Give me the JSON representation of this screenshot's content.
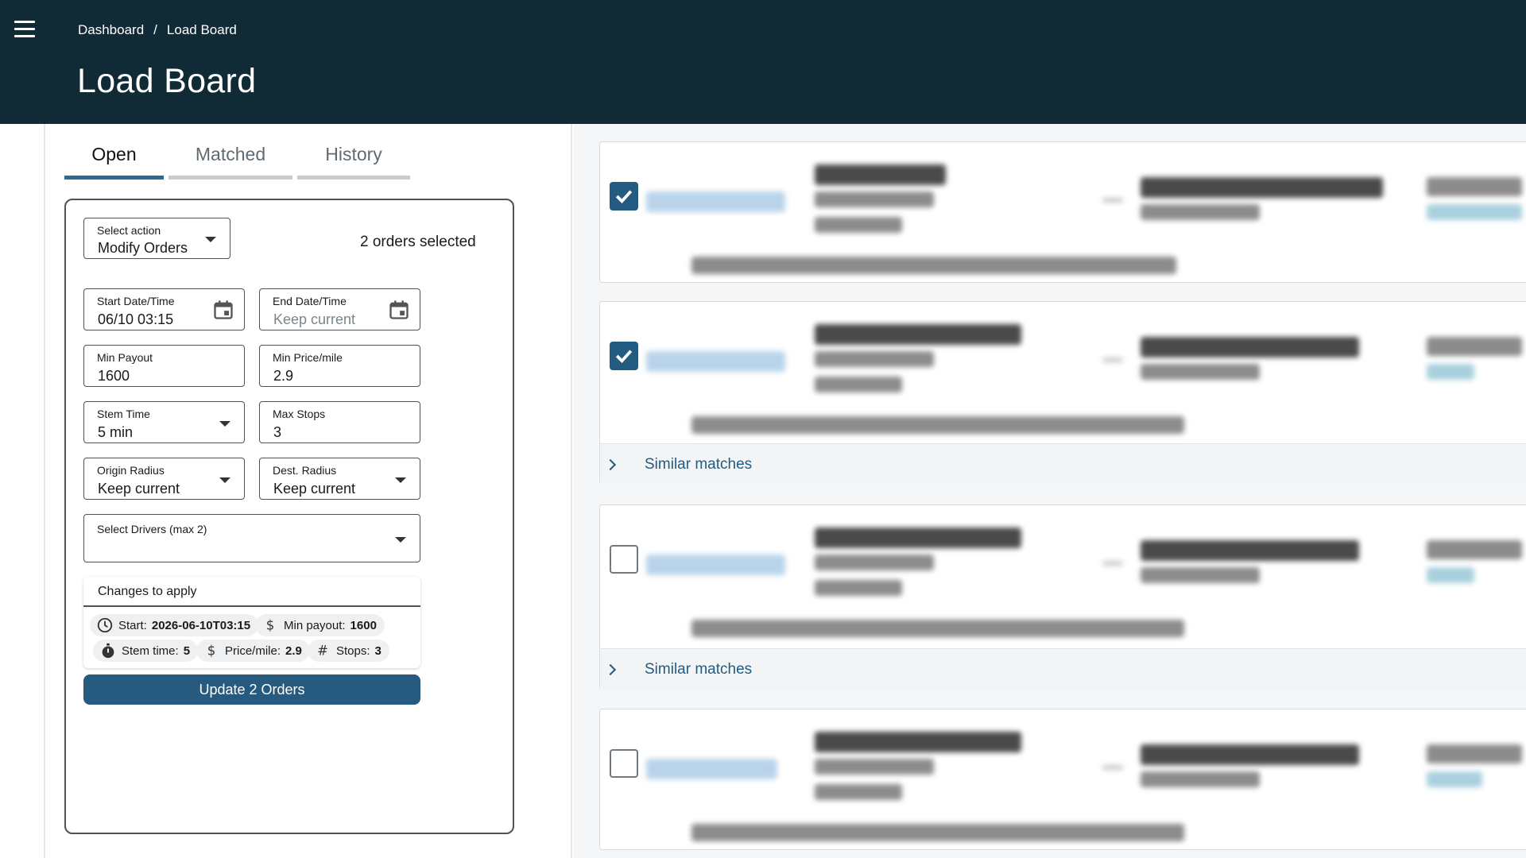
{
  "header": {
    "breadcrumb": [
      "Dashboard",
      "Load Board"
    ],
    "breadcrumb_separator": "/",
    "title": "Load Board",
    "bg_color": "#112b36"
  },
  "tabs": [
    {
      "label": "Open",
      "active": true
    },
    {
      "label": "Matched",
      "active": false
    },
    {
      "label": "History",
      "active": false
    }
  ],
  "form": {
    "select_action": {
      "label": "Select action",
      "value": "Modify Orders"
    },
    "orders_selected": "2 orders selected",
    "start_date": {
      "label": "Start Date/Time",
      "value": "06/10 03:15"
    },
    "end_date": {
      "label": "End Date/Time",
      "placeholder": "Keep current"
    },
    "min_payout": {
      "label": "Min Payout",
      "value": "1600"
    },
    "min_price_mile": {
      "label": "Min Price/mile",
      "value": "2.9"
    },
    "stem_time": {
      "label": "Stem Time",
      "value": "5 min"
    },
    "max_stops": {
      "label": "Max Stops",
      "value": "3"
    },
    "origin_radius": {
      "label": "Origin Radius",
      "value": "Keep current"
    },
    "dest_radius": {
      "label": "Dest. Radius",
      "value": "Keep current"
    },
    "select_drivers": {
      "label": "Select Drivers (max 2)",
      "value": ""
    }
  },
  "changes": {
    "title": "Changes to apply",
    "chips": [
      {
        "icon": "clock-icon",
        "label": "Start: ",
        "value": "2026-06-10T03:15"
      },
      {
        "icon": "dollar-icon",
        "label": "Min payout: ",
        "value": "1600"
      },
      {
        "icon": "stopwatch-icon",
        "label": "Stem time: ",
        "value": "5"
      },
      {
        "icon": "dollar-icon",
        "label": "Price/mile: ",
        "value": "2.9"
      },
      {
        "icon": "hash-icon",
        "label": "Stops: ",
        "value": "3"
      }
    ]
  },
  "update_button": "Update 2 Orders",
  "orders": [
    {
      "checked": true,
      "similar_matches": null
    },
    {
      "checked": true,
      "similar_matches": "Similar matches"
    },
    {
      "checked": false,
      "similar_matches": "Similar matches"
    },
    {
      "checked": false,
      "similar_matches": null
    }
  ],
  "colors": {
    "accent": "#245b80",
    "button": "#265a7e",
    "tab_active": "#2b6a92"
  }
}
